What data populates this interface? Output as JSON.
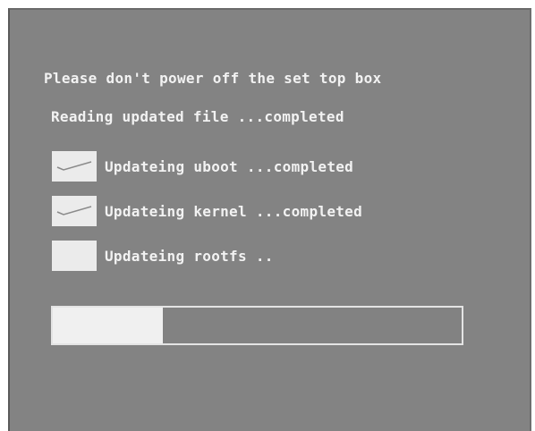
{
  "messages": {
    "warning": "Please don't power off the set top box",
    "reading": "Reading updated file ...completed"
  },
  "steps": [
    {
      "label": "Updateing uboot ...completed",
      "checked": true,
      "icon": "check-icon"
    },
    {
      "label": "Updateing kernel ...completed",
      "checked": true,
      "icon": "check-icon"
    },
    {
      "label": "Updateing rootfs ..",
      "checked": false,
      "icon": ""
    }
  ],
  "progress": {
    "fraction": 0.27
  },
  "colors": {
    "background": "#838383",
    "text": "#f2f2f2",
    "checkbox": "#ebebeb",
    "check_mark": "#8a8a8a",
    "progress_fill": "#f0f0f0",
    "progress_border": "#e4e4e4"
  }
}
